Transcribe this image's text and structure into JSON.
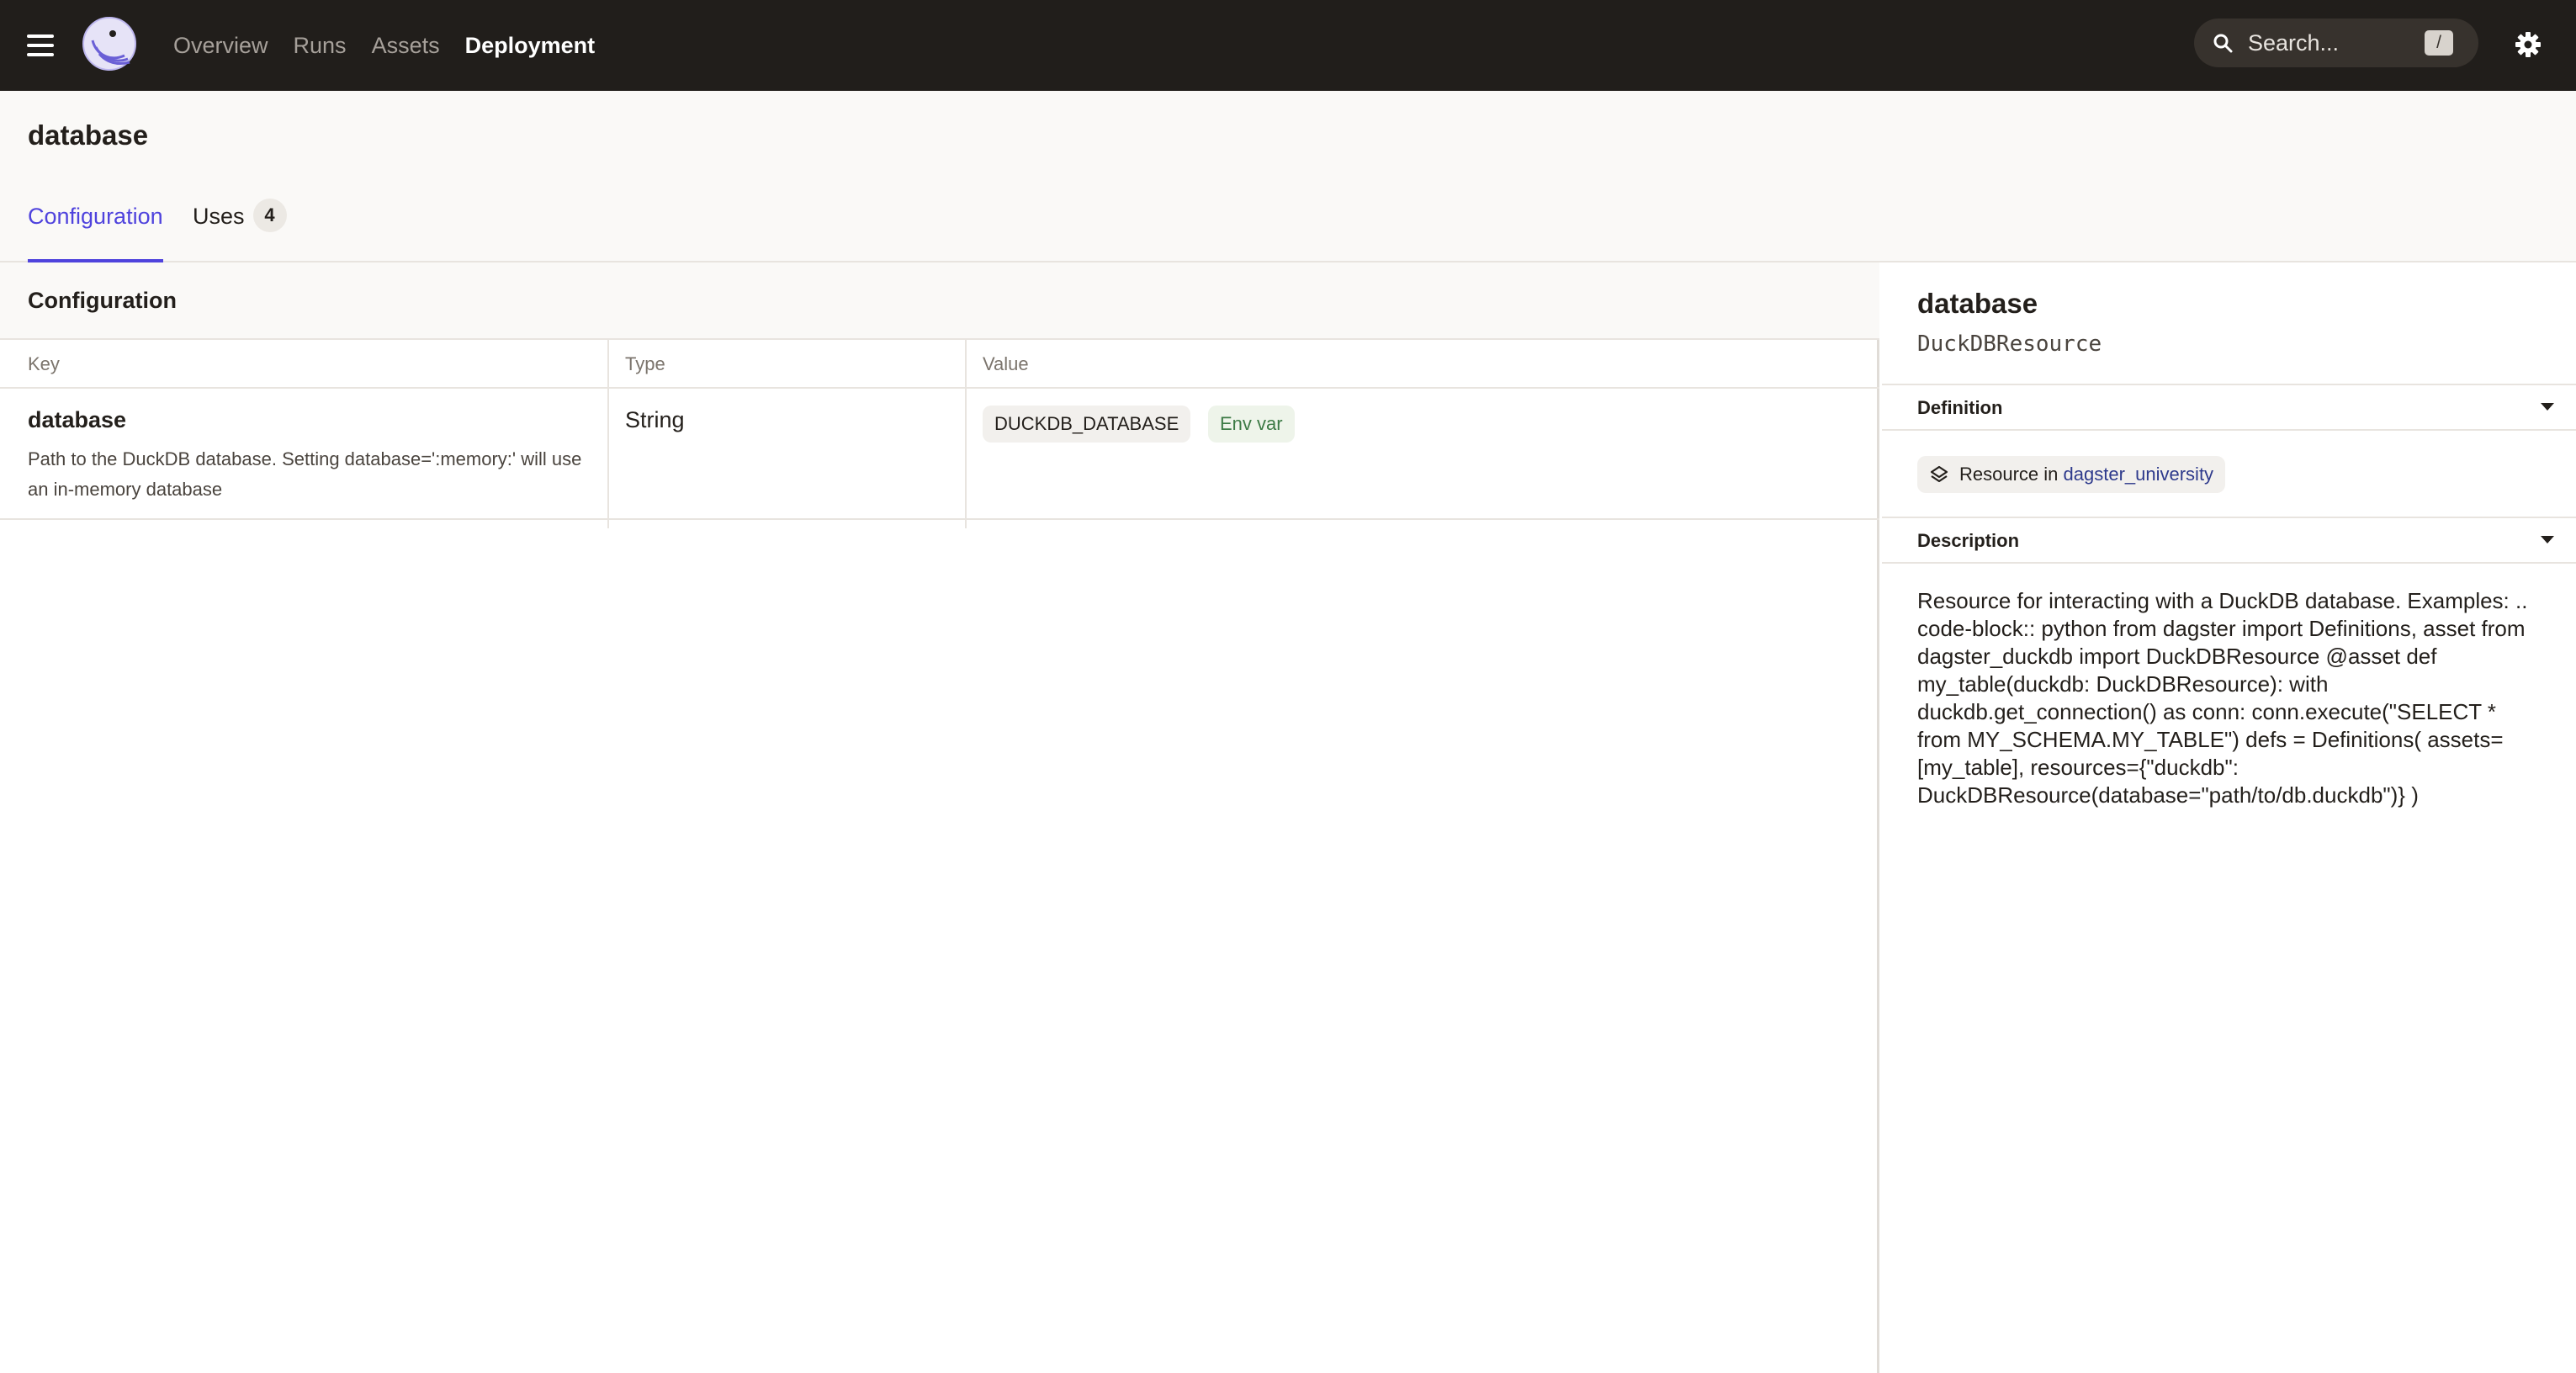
{
  "topnav": {
    "links": [
      {
        "label": "Overview"
      },
      {
        "label": "Runs"
      },
      {
        "label": "Assets"
      },
      {
        "label": "Deployment",
        "active": true
      }
    ],
    "search": {
      "placeholder": "Search...",
      "shortcut": "/"
    }
  },
  "header": {
    "title": "database",
    "tabs": {
      "configuration": {
        "label": "Configuration"
      },
      "uses": {
        "label": "Uses",
        "count": "4"
      }
    }
  },
  "configuration": {
    "section_title": "Configuration",
    "columns": {
      "key": "Key",
      "type": "Type",
      "value": "Value"
    },
    "rows": [
      {
        "key": "database",
        "description": "Path to the DuckDB database. Setting database=':memory:' will use an in-memory database",
        "type": "String",
        "value": "DUCKDB_DATABASE",
        "value_tag": "Env var"
      }
    ]
  },
  "sidebar": {
    "title": "database",
    "subtitle": "DuckDBResource",
    "definition": {
      "label": "Definition",
      "resource_prefix": "Resource in ",
      "resource_location": "dagster_university"
    },
    "description": {
      "label": "Description",
      "text": "Resource for interacting with a DuckDB database. Examples: .. code-block:: python from dagster import Definitions, asset from dagster_duckdb import DuckDBResource @asset def my_table(duckdb: DuckDBResource): with duckdb.get_connection() as conn: conn.execute(\"SELECT * from MY_SCHEMA.MY_TABLE\") defs = Definitions( assets=[my_table], resources={\"duckdb\": DuckDBResource(database=\"path/to/db.duckdb\")} )"
    }
  },
  "colors": {
    "nav_bg": "#211e1b",
    "accent": "#4f43dd",
    "env_tag": "#3c7a45",
    "link": "#2e3a8c"
  }
}
